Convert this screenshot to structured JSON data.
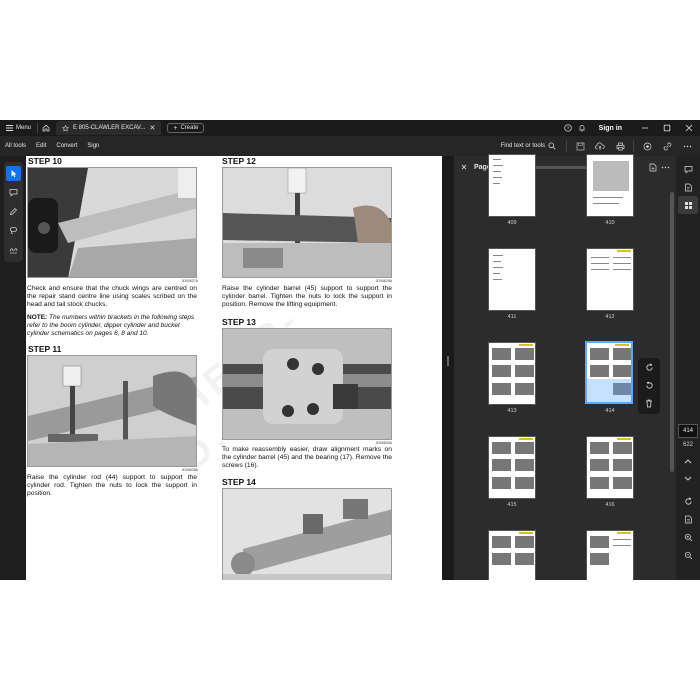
{
  "titlebar": {
    "menu_label": "Menu",
    "tab_title": "E 805-CLAWLER EXCAV...",
    "create_label": "Create",
    "signin_label": "Sign in"
  },
  "toolbar": {
    "menus": [
      "All tools",
      "Edit",
      "Convert",
      "Sign"
    ],
    "find_label": "Find text or tools"
  },
  "document": {
    "left_column": {
      "step10_title": "STEP 10",
      "step10_photo_code": "JD00627A",
      "step10_text": "Check and ensure that the chuck wings are centred on the repair stand centre line using scales scribed on the head and tail stock chucks.",
      "note_label": "NOTE:",
      "note_text": "The numbers within brackets in the following steps refer to the boom cylinder, dipper cylinder and bucket cylinder schematics on pages 6, 8 and 10.",
      "step11_title": "STEP 11",
      "step11_photo_code": "JD00628A",
      "step11_text": "Raise the cylinder rod (44) support to support the cylinder rod. Tighten the nuts to lock the support in position."
    },
    "right_column": {
      "step12_title": "STEP 12",
      "step12_photo_code": "JD00629A",
      "step12_text": "Raise the cylinder barrel (45) support to support the cylinder barrel. Tighten the nuts to lock the support in position. Remove the lifting equipment.",
      "step13_title": "STEP 13",
      "step13_photo_code": "JD00630A",
      "step13_text": "To make reassembly easier, draw alignment marks on the cylinder barrel (45) and the bearing (17). Remove the screws (16).",
      "step14_title": "STEP 14"
    },
    "watermark": "CHEAP-O.COM"
  },
  "pages_panel": {
    "title": "Pages",
    "zoom_fraction": 0.02,
    "thumbnails": [
      {
        "label": "409"
      },
      {
        "label": "410"
      },
      {
        "label": "411"
      },
      {
        "label": "412"
      },
      {
        "label": "413"
      },
      {
        "label": "414",
        "selected": true
      },
      {
        "label": "415"
      },
      {
        "label": "416"
      }
    ]
  },
  "page_indicator": {
    "current": "414",
    "total": "622"
  },
  "colors": {
    "accent": "#1473e6",
    "selection": "#5aa9ff",
    "chrome_dark": "#1e1e1e",
    "panel_bg": "#2c2c2c"
  }
}
